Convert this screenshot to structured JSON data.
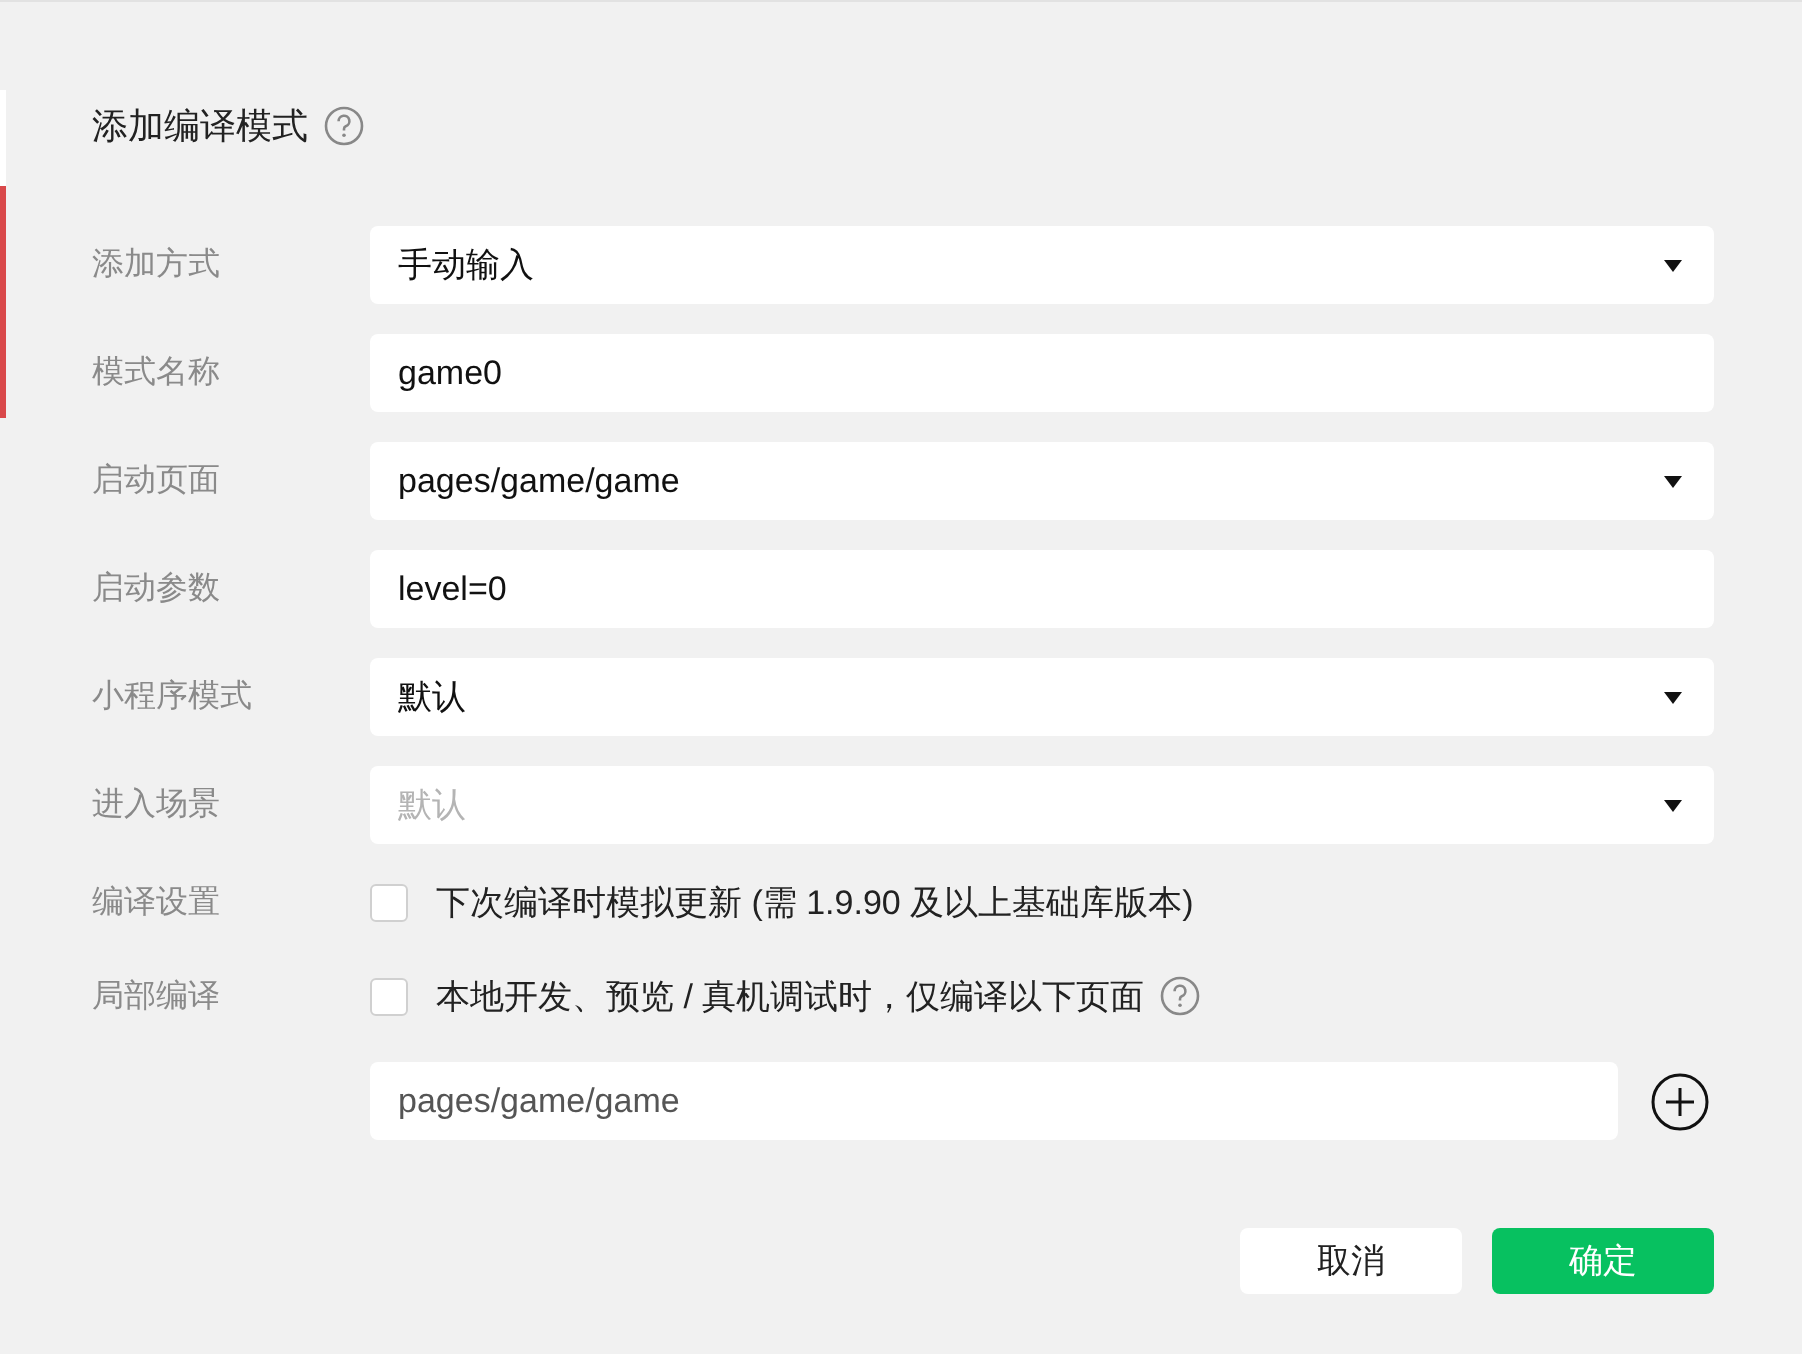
{
  "dialog": {
    "title": "添加编译模式",
    "title_help": true
  },
  "rows": [
    {
      "label": "添加方式",
      "kind": "select",
      "value": "手动输入"
    },
    {
      "label": "模式名称",
      "kind": "text",
      "value": "game0"
    },
    {
      "label": "启动页面",
      "kind": "select",
      "value": "pages/game/game"
    },
    {
      "label": "启动参数",
      "kind": "text",
      "value": "level=0"
    },
    {
      "label": "小程序模式",
      "kind": "select",
      "value": "默认"
    },
    {
      "label": "进入场景",
      "kind": "select",
      "placeholder": "默认"
    },
    {
      "label": "编译设置",
      "kind": "checkbox",
      "text": "下次编译时模拟更新 (需 1.9.90 及以上基础库版本)",
      "checked": false,
      "help": false
    },
    {
      "label": "局部编译",
      "kind": "checkbox",
      "text": "本地开发、预览 / 真机调试时，仅编译以下页面",
      "checked": false,
      "help": true
    },
    {
      "kind": "path",
      "value": "pages/game/game"
    }
  ],
  "buttons": [
    {
      "label": "取消",
      "kind": "secondary"
    },
    {
      "label": "确定",
      "kind": "primary"
    }
  ]
}
